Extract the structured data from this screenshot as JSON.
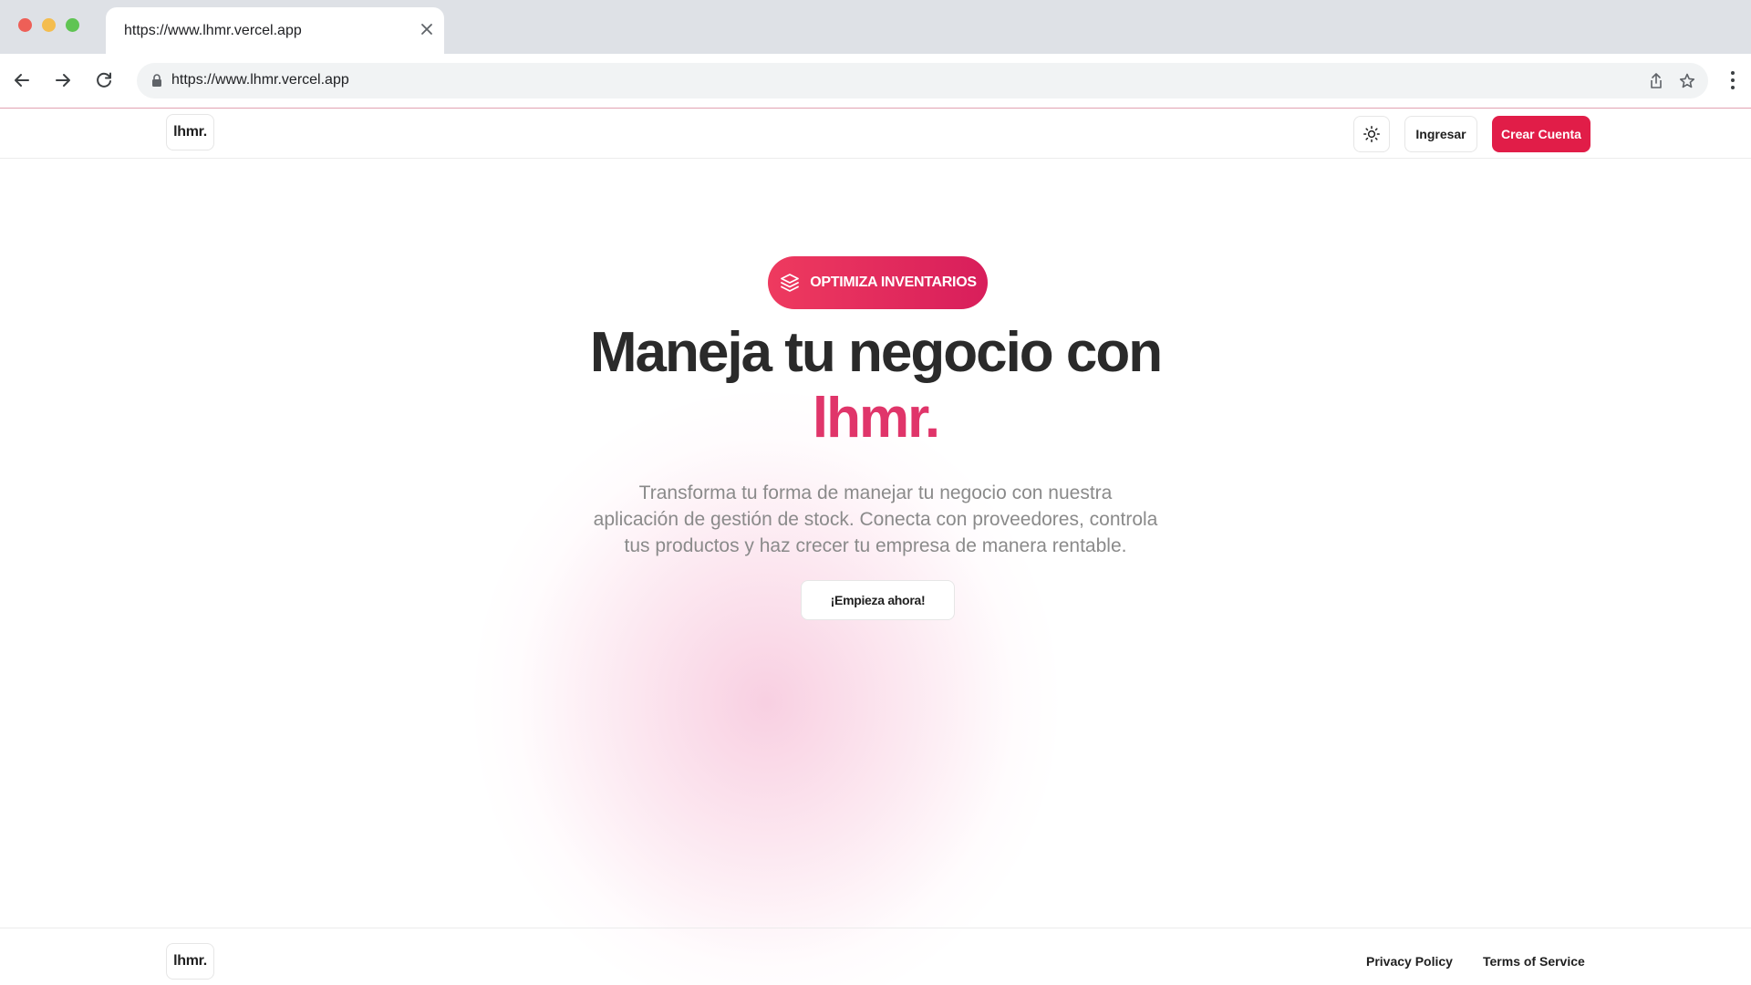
{
  "browser": {
    "tab_title": "https://www.lhmr.vercel.app",
    "url": "https://www.lhmr.vercel.app"
  },
  "header": {
    "logo": "lhmr.",
    "login_label": "Ingresar",
    "signup_label": "Crear Cuenta"
  },
  "hero": {
    "badge": "OPTIMIZA INVENTARIOS",
    "headline": "Maneja tu negocio con",
    "brand": "lhmr.",
    "subtitle_line1": "Transforma tu forma de manejar tu negocio con nuestra",
    "subtitle_line2": "aplicación de gestión de stock. Conecta con proveedores, controla",
    "subtitle_line3": "tus productos y haz crecer tu empresa de manera rentable.",
    "cta_label": "¡Empieza ahora!"
  },
  "footer": {
    "logo": "lhmr.",
    "privacy_label": "Privacy Policy",
    "terms_label": "Terms of Service"
  },
  "colors": {
    "accent": "#e11d48",
    "brand_text": "#e0356a"
  },
  "icons": {
    "badge": "layers-icon",
    "theme": "sun-icon"
  }
}
